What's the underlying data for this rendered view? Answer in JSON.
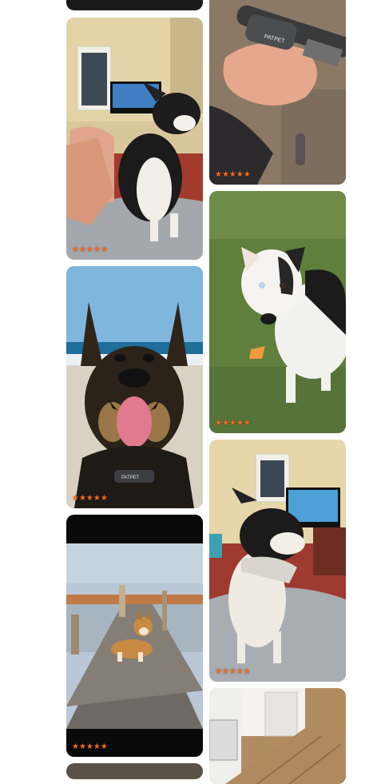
{
  "gallery": {
    "rating_stars": "★★★★★",
    "accent_color": "#f26b1d",
    "cards": [
      {
        "subject": "card-top-partial"
      },
      {
        "subject": "chihuahua-on-couch"
      },
      {
        "subject": "hand-holding-collar-device"
      },
      {
        "subject": "border-collie-on-grass"
      },
      {
        "subject": "german-shepherd-on-beach"
      },
      {
        "subject": "chihuahua-on-sofa"
      },
      {
        "subject": "corgi-on-pier"
      },
      {
        "subject": "kitchen-floor-partial"
      },
      {
        "subject": "card-bottom-partial"
      }
    ]
  }
}
